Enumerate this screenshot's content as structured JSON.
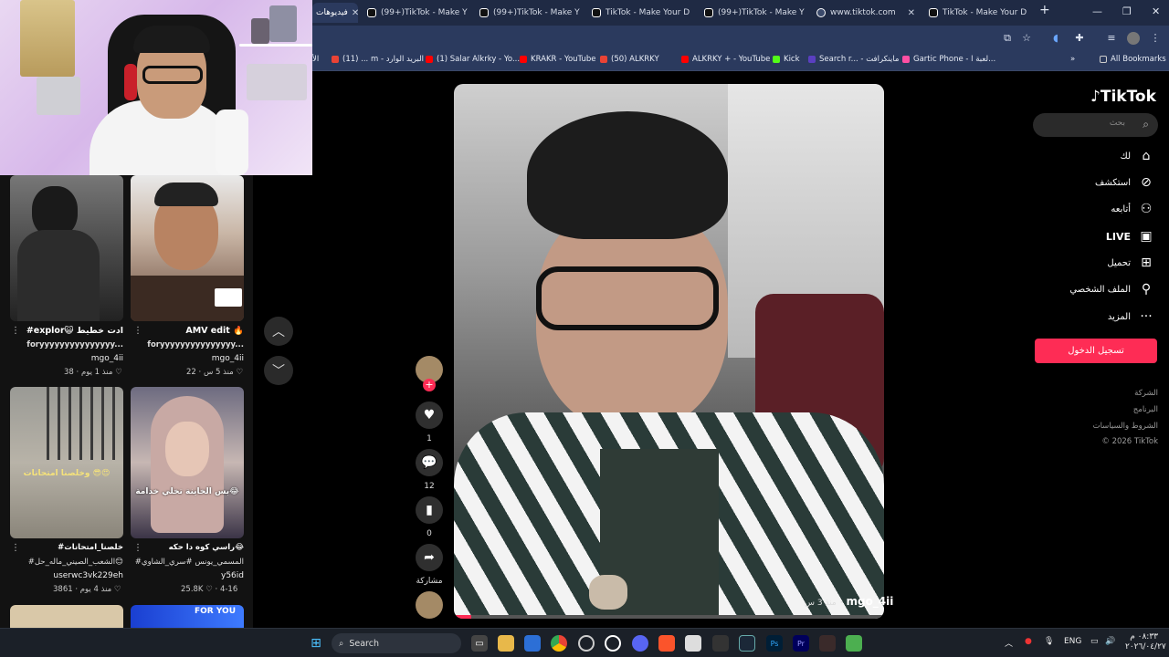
{
  "browser": {
    "tabs": [
      {
        "label": "فيديوهات",
        "active": true
      },
      {
        "label": "(99+)TikTok - Make Y"
      },
      {
        "label": "(99+)TikTok - Make Y"
      },
      {
        "label": "TikTok - Make Your D"
      },
      {
        "label": "(99+)TikTok - Make Y"
      },
      {
        "label": "www.tiktok.com"
      },
      {
        "label": "TikTok - Make Your D"
      }
    ],
    "new_tab": "+",
    "bookmarks": [
      {
        "label": "الأ"
      },
      {
        "label": "(11) ... m - البريد الوارد"
      },
      {
        "label": "(1) Salar Alkrky - Yo..."
      },
      {
        "label": "KRAKR - YouTube"
      },
      {
        "label": "(50) ALKRKY"
      },
      {
        "label": "ALKRKY + - YouTube"
      },
      {
        "label": "Kick"
      },
      {
        "label": "Search r... - ماينكرافت"
      },
      {
        "label": "Gartic Phone - لعبة ا..."
      }
    ],
    "all_bookmarks": "All Bookmarks"
  },
  "feed": {
    "cards": [
      {
        "title": "#explor😺 ادت خطيط",
        "sub": "foryyyyyyyyyyyyyyy...",
        "author": "mgo_4ii",
        "likes": "38",
        "time": "منذ 1 يوم"
      },
      {
        "title": "AMV edit 🔥",
        "sub": "foryyyyyyyyyyyyyyy...",
        "author": "mgo_4ii",
        "likes": "22",
        "time": "منذ 5 س"
      },
      {
        "title": "#خلصنا_امتحانات",
        "sub": "#الشعب_الصيني_ماله_حل😊",
        "author": "userwc3vk229eh",
        "likes": "3861",
        "time": "منذ 4 يوم",
        "overlay": "وخلصنا امتحانات 😎😍"
      },
      {
        "title": "راسي كوه دا حكه😂",
        "sub": "#المسمي_يونس #سري_الشاوي",
        "author": "y56id",
        "likes": "25.8K",
        "time": "4-16",
        "overlay": "بس الخاينة تخلي خدامة😂"
      },
      {
        "title": "",
        "sub": "",
        "author": "",
        "likes": "",
        "time": "",
        "overlay": "FOR YOU"
      }
    ]
  },
  "player": {
    "author": "mgo_4ii",
    "time_ago": "منذ 3 س",
    "likes": "1",
    "comments": "12",
    "saves": "0",
    "share_label": "مشاركة"
  },
  "sidebar": {
    "logo": "TikTok",
    "search_placeholder": "بحث",
    "nav": [
      {
        "label": "لك",
        "icon": "home-icon"
      },
      {
        "label": "استكشف",
        "icon": "compass-icon"
      },
      {
        "label": "أتابعه",
        "icon": "user-follow-icon"
      },
      {
        "label": "LIVE",
        "icon": "live-icon"
      },
      {
        "label": "تحميل",
        "icon": "upload-icon"
      },
      {
        "label": "الملف الشخصي",
        "icon": "profile-icon"
      },
      {
        "label": "المزيد",
        "icon": "more-icon"
      }
    ],
    "login": "تسجيل الدخول",
    "footer": [
      "الشركة",
      "البرنامج",
      "الشروط والسياسات",
      "© 2026 TikTok"
    ]
  },
  "taskbar": {
    "search": "Search",
    "lang": "ENG",
    "time": "٠٨:٣٣ م",
    "date": "٢٠٢٦/٠٤/٢٧"
  },
  "colors": {
    "accent": "#fe2c55",
    "chrome": "#2b3a5e"
  }
}
